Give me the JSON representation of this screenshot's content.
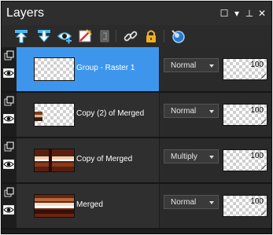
{
  "panel": {
    "title": "Layers",
    "window_buttons": [
      {
        "name": "maximize",
        "glyph": "☐"
      },
      {
        "name": "menu",
        "glyph": "▾"
      },
      {
        "name": "pin",
        "glyph": "⊥"
      },
      {
        "name": "close",
        "glyph": "✕"
      }
    ]
  },
  "toolbar": {
    "icons": [
      "move-layer-up-icon",
      "move-layer-down-icon",
      "visibility-toggle-icon",
      "no-mask-icon",
      "mask-icon",
      "link-icon",
      "lock-icon",
      "layer-properties-icon"
    ]
  },
  "colors": {
    "selected_row": "#3d96ec",
    "toolbar_accent": "#4db8f0",
    "panel_background": "#1f1f1f"
  },
  "layers": [
    {
      "name": "Group - Raster 1",
      "blend_mode": "Normal",
      "opacity": "100",
      "selected": true,
      "type": "group"
    },
    {
      "name": "Copy (2) of Merged",
      "blend_mode": "Normal",
      "opacity": "100",
      "selected": false,
      "type": "raster"
    },
    {
      "name": "Copy of Merged",
      "blend_mode": "Multiply",
      "opacity": "100",
      "selected": false,
      "type": "raster"
    },
    {
      "name": "Merged",
      "blend_mode": "Normal",
      "opacity": "100",
      "selected": false,
      "type": "raster"
    }
  ]
}
